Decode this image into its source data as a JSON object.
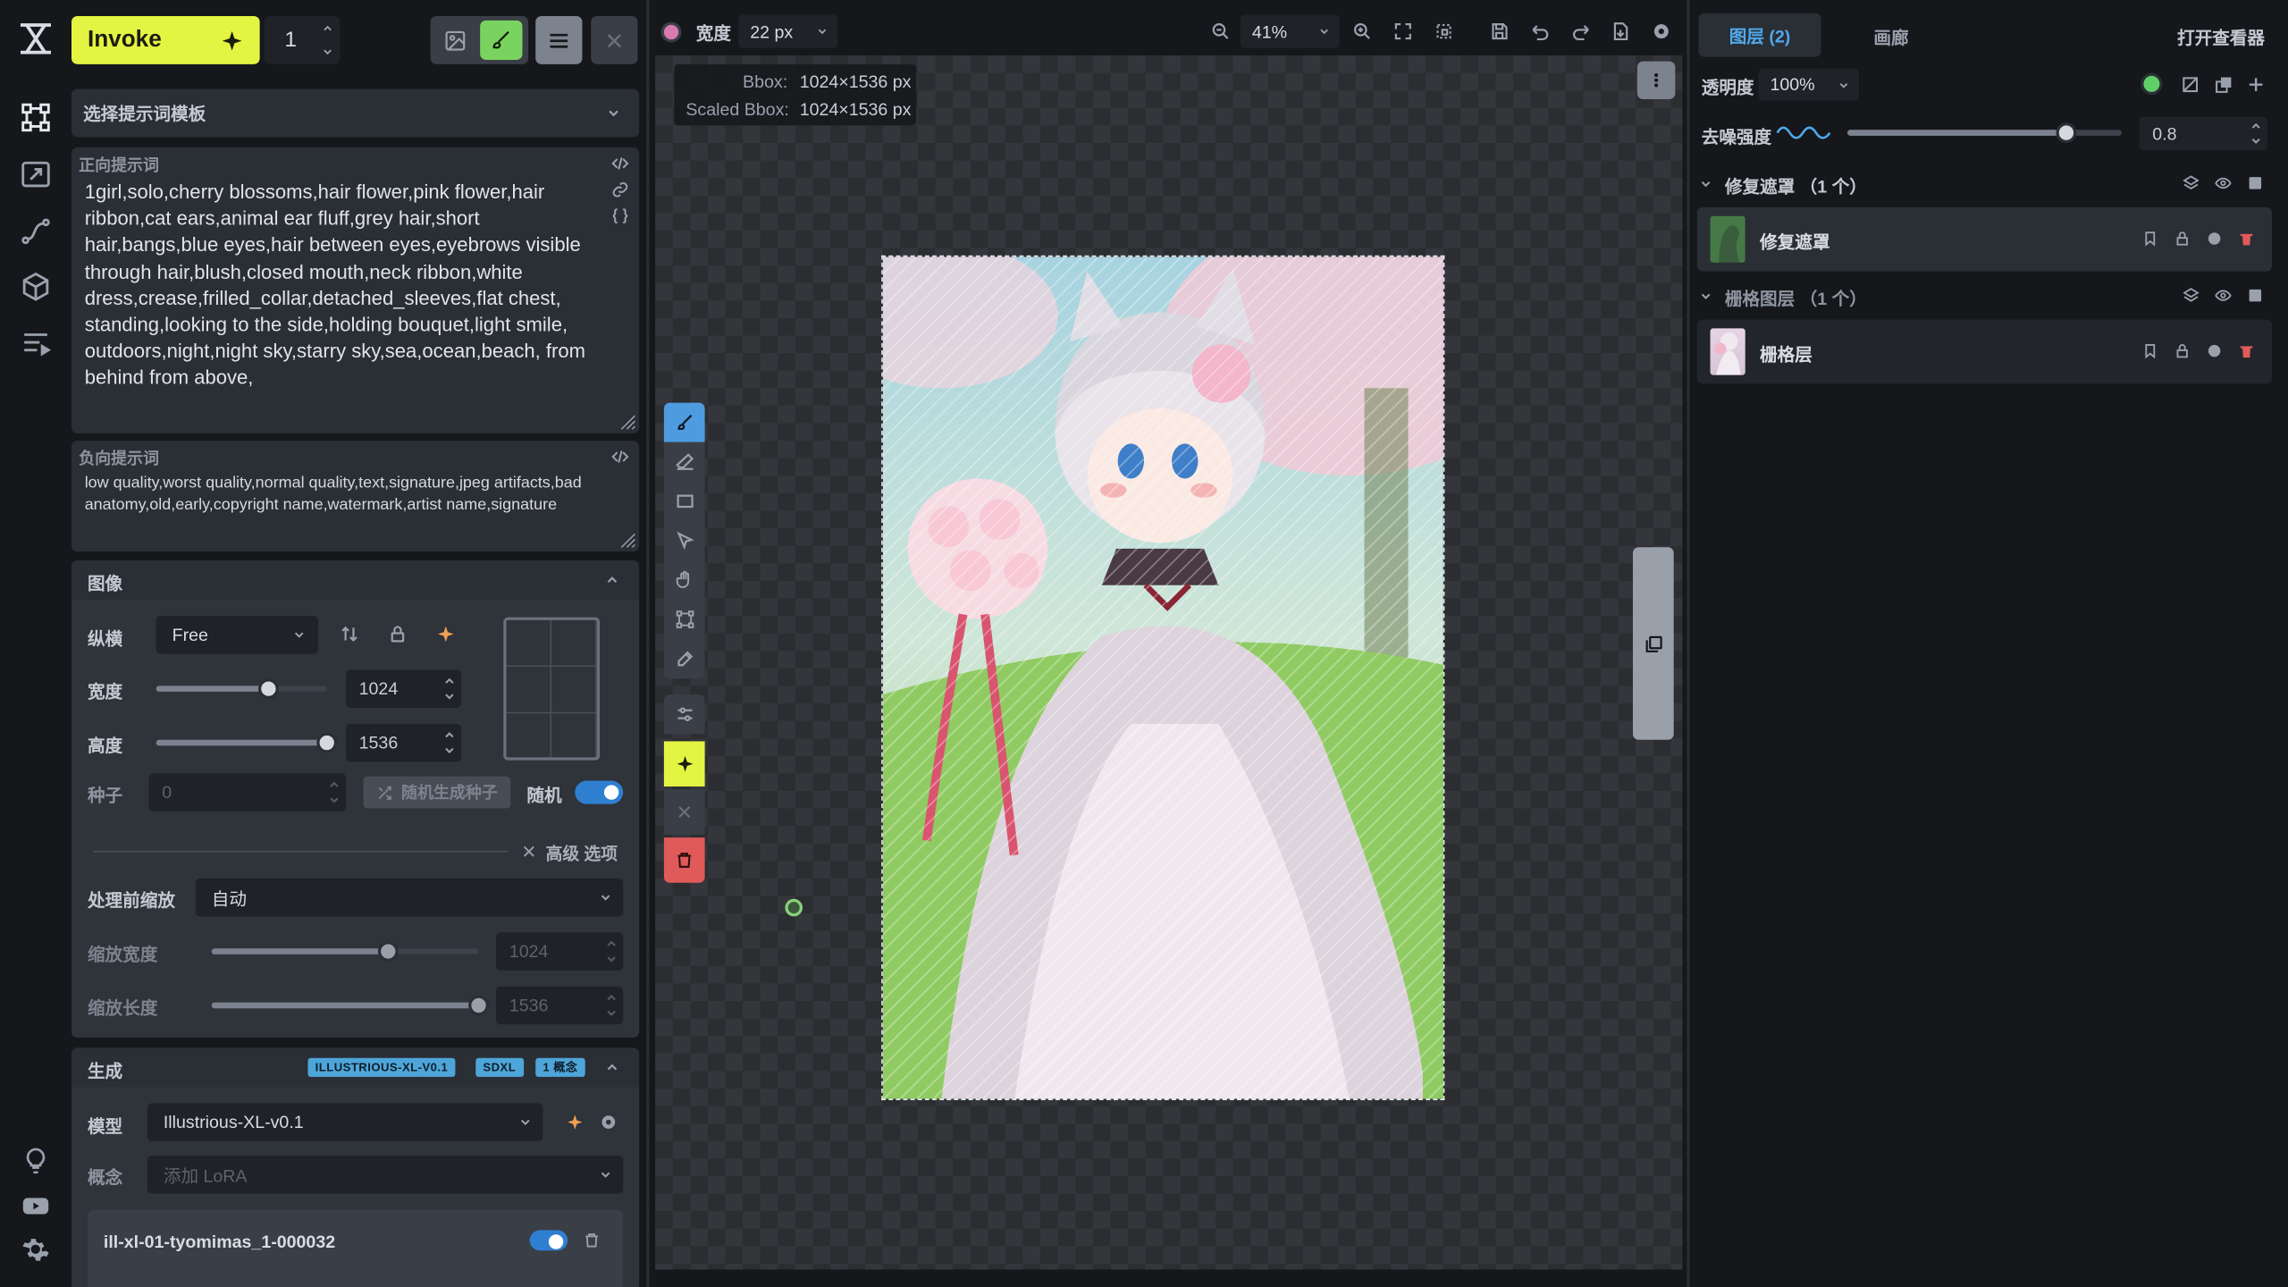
{
  "app": {
    "name": "Invoke",
    "queue_count": "1"
  },
  "prompt": {
    "template_label": "选择提示词模板",
    "positive_label": "正向提示词",
    "positive_text": "1girl,solo,cherry blossoms,hair flower,pink flower,hair ribbon,cat ears,animal ear fluff,grey hair,short hair,bangs,blue eyes,hair between eyes,eyebrows visible through hair,blush,closed mouth,neck ribbon,white dress,crease,frilled_collar,detached_sleeves,flat chest, standing,looking to the side,holding bouquet,light smile, outdoors,night,night sky,starry sky,sea,ocean,beach, from behind from above,",
    "negative_label": "负向提示词",
    "negative_text": "low quality,worst quality,normal quality,text,signature,jpeg artifacts,bad anatomy,old,early,copyright name,watermark,artist name,signature"
  },
  "image": {
    "section_label": "图像",
    "aspect_label": "纵横",
    "aspect_value": "Free",
    "width_label": "宽度",
    "width_value": "1024",
    "width_fraction": 0.66,
    "height_label": "高度",
    "height_value": "1536",
    "height_fraction": 1.0,
    "seed_label": "种子",
    "seed_value": "0",
    "random_seed_button": "随机生成种子",
    "random_label": "随机",
    "advanced_label": "高级 选项",
    "pre_scale_label": "处理前缩放",
    "pre_scale_value": "自动",
    "scaled_width_label": "缩放宽度",
    "scaled_width_value": "1024",
    "scaled_width_fraction": 0.66,
    "scaled_height_label": "缩放长度",
    "scaled_height_value": "1536",
    "scaled_height_fraction": 1.0
  },
  "generation": {
    "section_label": "生成",
    "badges": [
      "ILLUSTRIOUS-XL-V0.1",
      "SDXL",
      "1 概念"
    ],
    "model_label": "模型",
    "model_value": "Illustrious-XL-v0.1",
    "concept_label": "概念",
    "concept_placeholder": "添加 LoRA",
    "lora_name": "ill-xl-01-tyomimas_1-000032"
  },
  "canvas_toolbar": {
    "brush_width_label": "宽度",
    "brush_width_value": "22 px",
    "zoom_value": "41%",
    "bbox_label": "Bbox:",
    "bbox_value": "1024×1536 px",
    "scaled_bbox_label": "Scaled Bbox:",
    "scaled_bbox_value": "1024×1536 px"
  },
  "right": {
    "tab_layers": "图层 (2)",
    "tab_gallery": "画廊",
    "open_viewer": "打开查看器",
    "opacity_label": "透明度",
    "opacity_value": "100%",
    "denoise_label": "去噪强度",
    "denoise_value": "0.8",
    "denoise_fraction": 0.8,
    "inpaint_group": "修复遮罩 （1 个）",
    "inpaint_layer": "修复遮罩",
    "raster_group": "栅格图层 （1 个）",
    "raster_layer": "栅格层"
  },
  "colors": {
    "accent": "#e3f542",
    "brush": "#d77ab0",
    "toggle": "#2f7fd1",
    "delete": "#e05a5a",
    "status_green": "#5fd068",
    "badge": "#4ea5d9"
  }
}
